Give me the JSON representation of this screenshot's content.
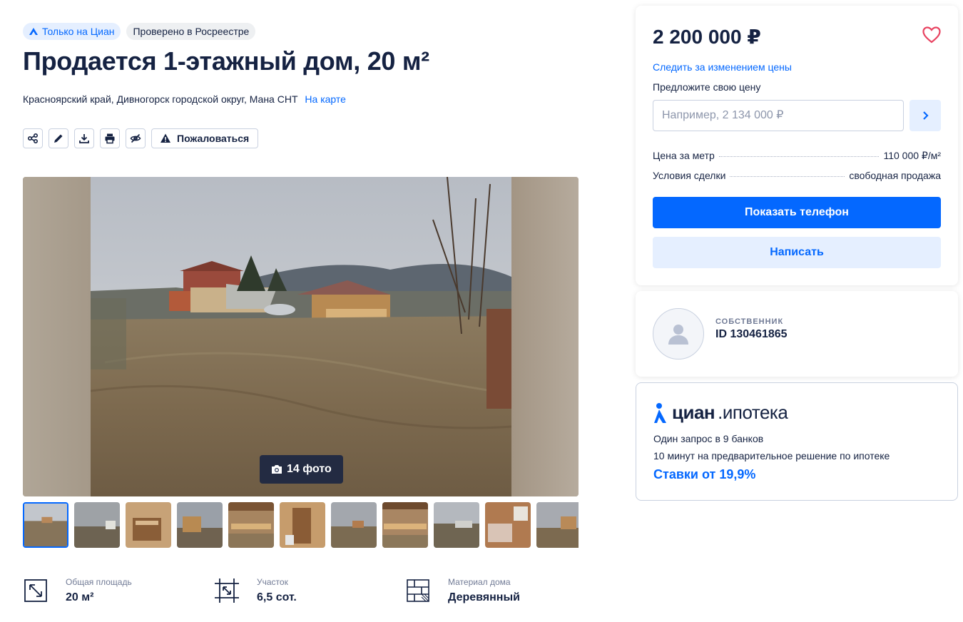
{
  "badges": {
    "cian_only": "Только на Циан",
    "rosreestr": "Проверено в Росреестре"
  },
  "title": "Продается 1-этажный дом, 20 м²",
  "address": {
    "text": "Красноярский край, Дивногорск городской округ, Мана СНТ",
    "map_link": "На карте"
  },
  "actions": {
    "icons": [
      "share-icon",
      "edit-icon",
      "download-icon",
      "print-icon",
      "hide-icon"
    ],
    "complain_label": "Пожаловаться"
  },
  "gallery": {
    "photo_count_label": "14 фото",
    "thumbnail_count": 11
  },
  "features": [
    {
      "label": "Общая площадь",
      "value": "20 м²",
      "icon": "area-icon"
    },
    {
      "label": "Участок",
      "value": "6,5 сот.",
      "icon": "plot-icon"
    },
    {
      "label": "Материал дома",
      "value": "Деревянный",
      "icon": "material-icon"
    }
  ],
  "price_card": {
    "price": "2 200 000 ₽",
    "track_price_link": "Следить за изменением цены",
    "offer_label": "Предложите свою цену",
    "offer_placeholder": "Например, 2 134 000 ₽",
    "rows": [
      {
        "label": "Цена за метр",
        "value": "110 000 ₽/м²"
      },
      {
        "label": "Условия сделки",
        "value": "свободная продажа"
      }
    ],
    "show_phone": "Показать телефон",
    "write": "Написать"
  },
  "owner": {
    "role": "СОБСТВЕННИК",
    "id": "ID 130461865"
  },
  "mortgage": {
    "brand": "циан",
    "product": ".ипотека",
    "line1": "Один запрос в 9 банков",
    "line2": "10 минут на предварительное решение по ипотеке",
    "rates": "Ставки от 19,9%"
  },
  "colors": {
    "accent": "#0468ff",
    "text": "#152242",
    "muted": "#707a95",
    "heart": "#e84260"
  }
}
